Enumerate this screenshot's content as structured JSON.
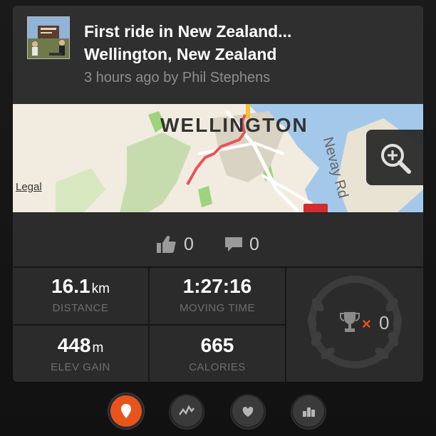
{
  "activity": {
    "title": "First ride in New Zealand...",
    "location": "Wellington, New Zealand",
    "meta": "3 hours ago by Phil Stephens"
  },
  "map": {
    "city_label": "WELLINGTON",
    "road_label": "Nevay Rd",
    "legal_link": "Legal",
    "zoom_icon": "zoom-in-magnifier-icon"
  },
  "social": {
    "kudos_count": "0",
    "comment_count": "0",
    "kudos_icon": "thumbs-up-icon",
    "comment_icon": "speech-bubble-icon"
  },
  "stats": {
    "distance": {
      "value": "16.1",
      "unit": "km",
      "label": "DISTANCE"
    },
    "moving_time": {
      "value": "1:27:16",
      "label": "MOVING TIME"
    },
    "elev_gain": {
      "value": "448",
      "unit": "m",
      "label": "ELEV GAIN"
    },
    "calories": {
      "value": "665",
      "label": "CALORIES"
    }
  },
  "achievements": {
    "count": "0",
    "multiplier": "×",
    "icon": "trophy-icon"
  },
  "bottom_nav": [
    {
      "name": "map-pin-icon",
      "active": true
    },
    {
      "name": "analysis-graph-icon",
      "active": false
    },
    {
      "name": "heart-rate-icon",
      "active": false
    },
    {
      "name": "segments-podium-icon",
      "active": false
    }
  ],
  "colors": {
    "accent": "#e8541c",
    "route": "#e8545a",
    "card": "#2e2e2e",
    "background": "#141414"
  }
}
